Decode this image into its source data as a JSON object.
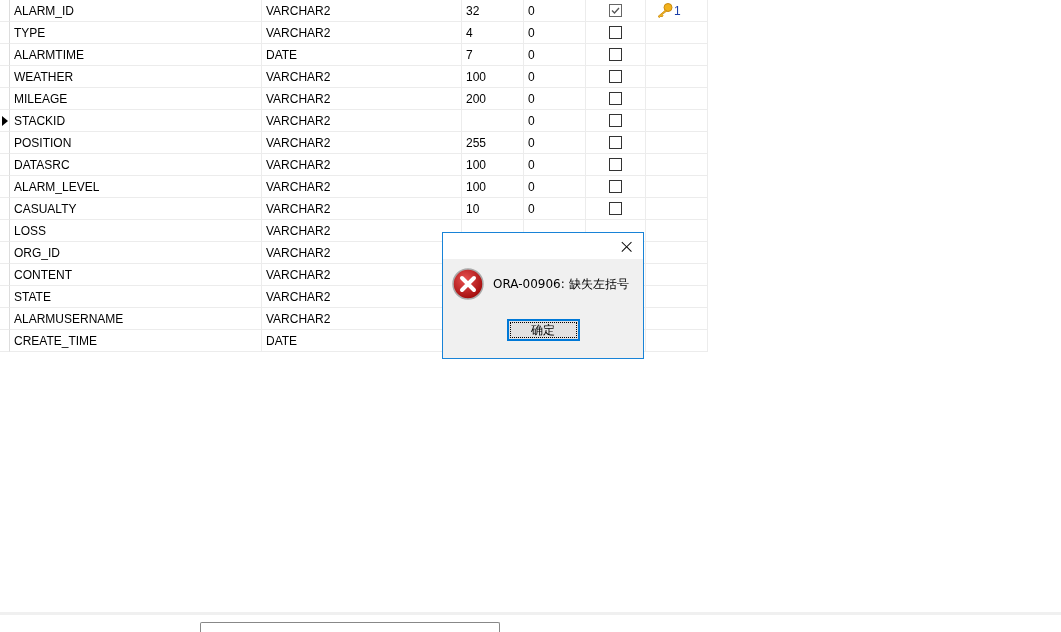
{
  "table": {
    "rows": [
      {
        "name": "ALARM_ID",
        "type": "VARCHAR2",
        "length": "32",
        "decimals": "0",
        "not_null": true,
        "key": "1",
        "current": false
      },
      {
        "name": "TYPE",
        "type": "VARCHAR2",
        "length": "4",
        "decimals": "0",
        "not_null": false,
        "current": false
      },
      {
        "name": "ALARMTIME",
        "type": "DATE",
        "length": "7",
        "decimals": "0",
        "not_null": false,
        "current": false
      },
      {
        "name": "WEATHER",
        "type": "VARCHAR2",
        "length": "100",
        "decimals": "0",
        "not_null": false,
        "current": false
      },
      {
        "name": "MILEAGE",
        "type": "VARCHAR2",
        "length": "200",
        "decimals": "0",
        "not_null": false,
        "current": false
      },
      {
        "name": "STACKID",
        "type": "VARCHAR2",
        "decimals": "0",
        "not_null": false,
        "current": true
      },
      {
        "name": "POSITION",
        "type": "VARCHAR2",
        "length": "255",
        "decimals": "0",
        "not_null": false,
        "current": false
      },
      {
        "name": "DATASRC",
        "type": "VARCHAR2",
        "length": "100",
        "decimals": "0",
        "not_null": false,
        "current": false
      },
      {
        "name": "ALARM_LEVEL",
        "type": "VARCHAR2",
        "length": "100",
        "decimals": "0",
        "not_null": false,
        "current": false
      },
      {
        "name": "CASUALTY",
        "type": "VARCHAR2",
        "length": "10",
        "decimals": "0",
        "not_null": false,
        "current": false
      },
      {
        "name": "LOSS",
        "type": "VARCHAR2",
        "current": false
      },
      {
        "name": "ORG_ID",
        "type": "VARCHAR2",
        "current": false
      },
      {
        "name": "CONTENT",
        "type": "VARCHAR2",
        "current": false
      },
      {
        "name": "STATE",
        "type": "VARCHAR2",
        "current": false
      },
      {
        "name": "ALARMUSERNAME",
        "type": "VARCHAR2",
        "current": false
      },
      {
        "name": "CREATE_TIME",
        "type": "DATE",
        "current": false
      }
    ]
  },
  "dialog": {
    "close": "×",
    "message": "ORA-00906: 缺失左括号",
    "button": "确定"
  }
}
